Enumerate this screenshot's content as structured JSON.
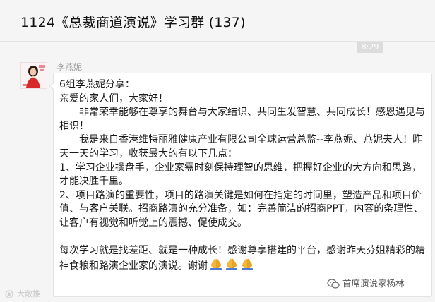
{
  "header": {
    "title": "1124《总裁商道演说》学习群 (137)"
  },
  "chat": {
    "timestamp": "8:29",
    "message": {
      "sender": "李燕妮",
      "avatar_icon": "avatar-woman-red-dress",
      "lines": {
        "l1": "6组李燕妮分享：",
        "l2": "亲爱的家人们，大家好！",
        "l3": "非常荣幸能够在尊享的舞台与大家结识、共同生发智慧、共同成长！感恩遇见与相识！",
        "l4": "我是来自香港维特丽雅健康产业有限公司全球运营总监--李燕妮、燕妮夫人！昨天一天的学习，收获最大的有以下几点：",
        "l5": "1、学习企业操盘手，企业家需时刻保持理智的思维，把握好企业的大方向和思路，才能决胜千里。",
        "l6": "2、项目路演的重要性，项目的路演关键是如何在指定的时间里，塑造产品和项目价值、与客户关联。招商路演的充分准备，如：完善简洁的招商PPT，内容的条理性、让客户有视觉和听觉上的震撼、促使成交。",
        "l7": "每次学习就是找差距、就是一种成长！感谢尊享搭建的平台，感谢昨天芬姐精彩的精神食粮和路演企业家的演说。谢谢"
      },
      "emoji": [
        "folded-hands-emoji",
        "folded-hands-emoji",
        "folded-hands-emoji"
      ]
    }
  },
  "watermarks": {
    "left": "大敞推",
    "right": "首席演说家杨林"
  },
  "colors": {
    "background": "#f5f5f5",
    "bubble": "#ffffff",
    "text": "#1a1a1a",
    "sender": "#9a9a9a",
    "timestamp_bg": "#dcdcdc"
  }
}
